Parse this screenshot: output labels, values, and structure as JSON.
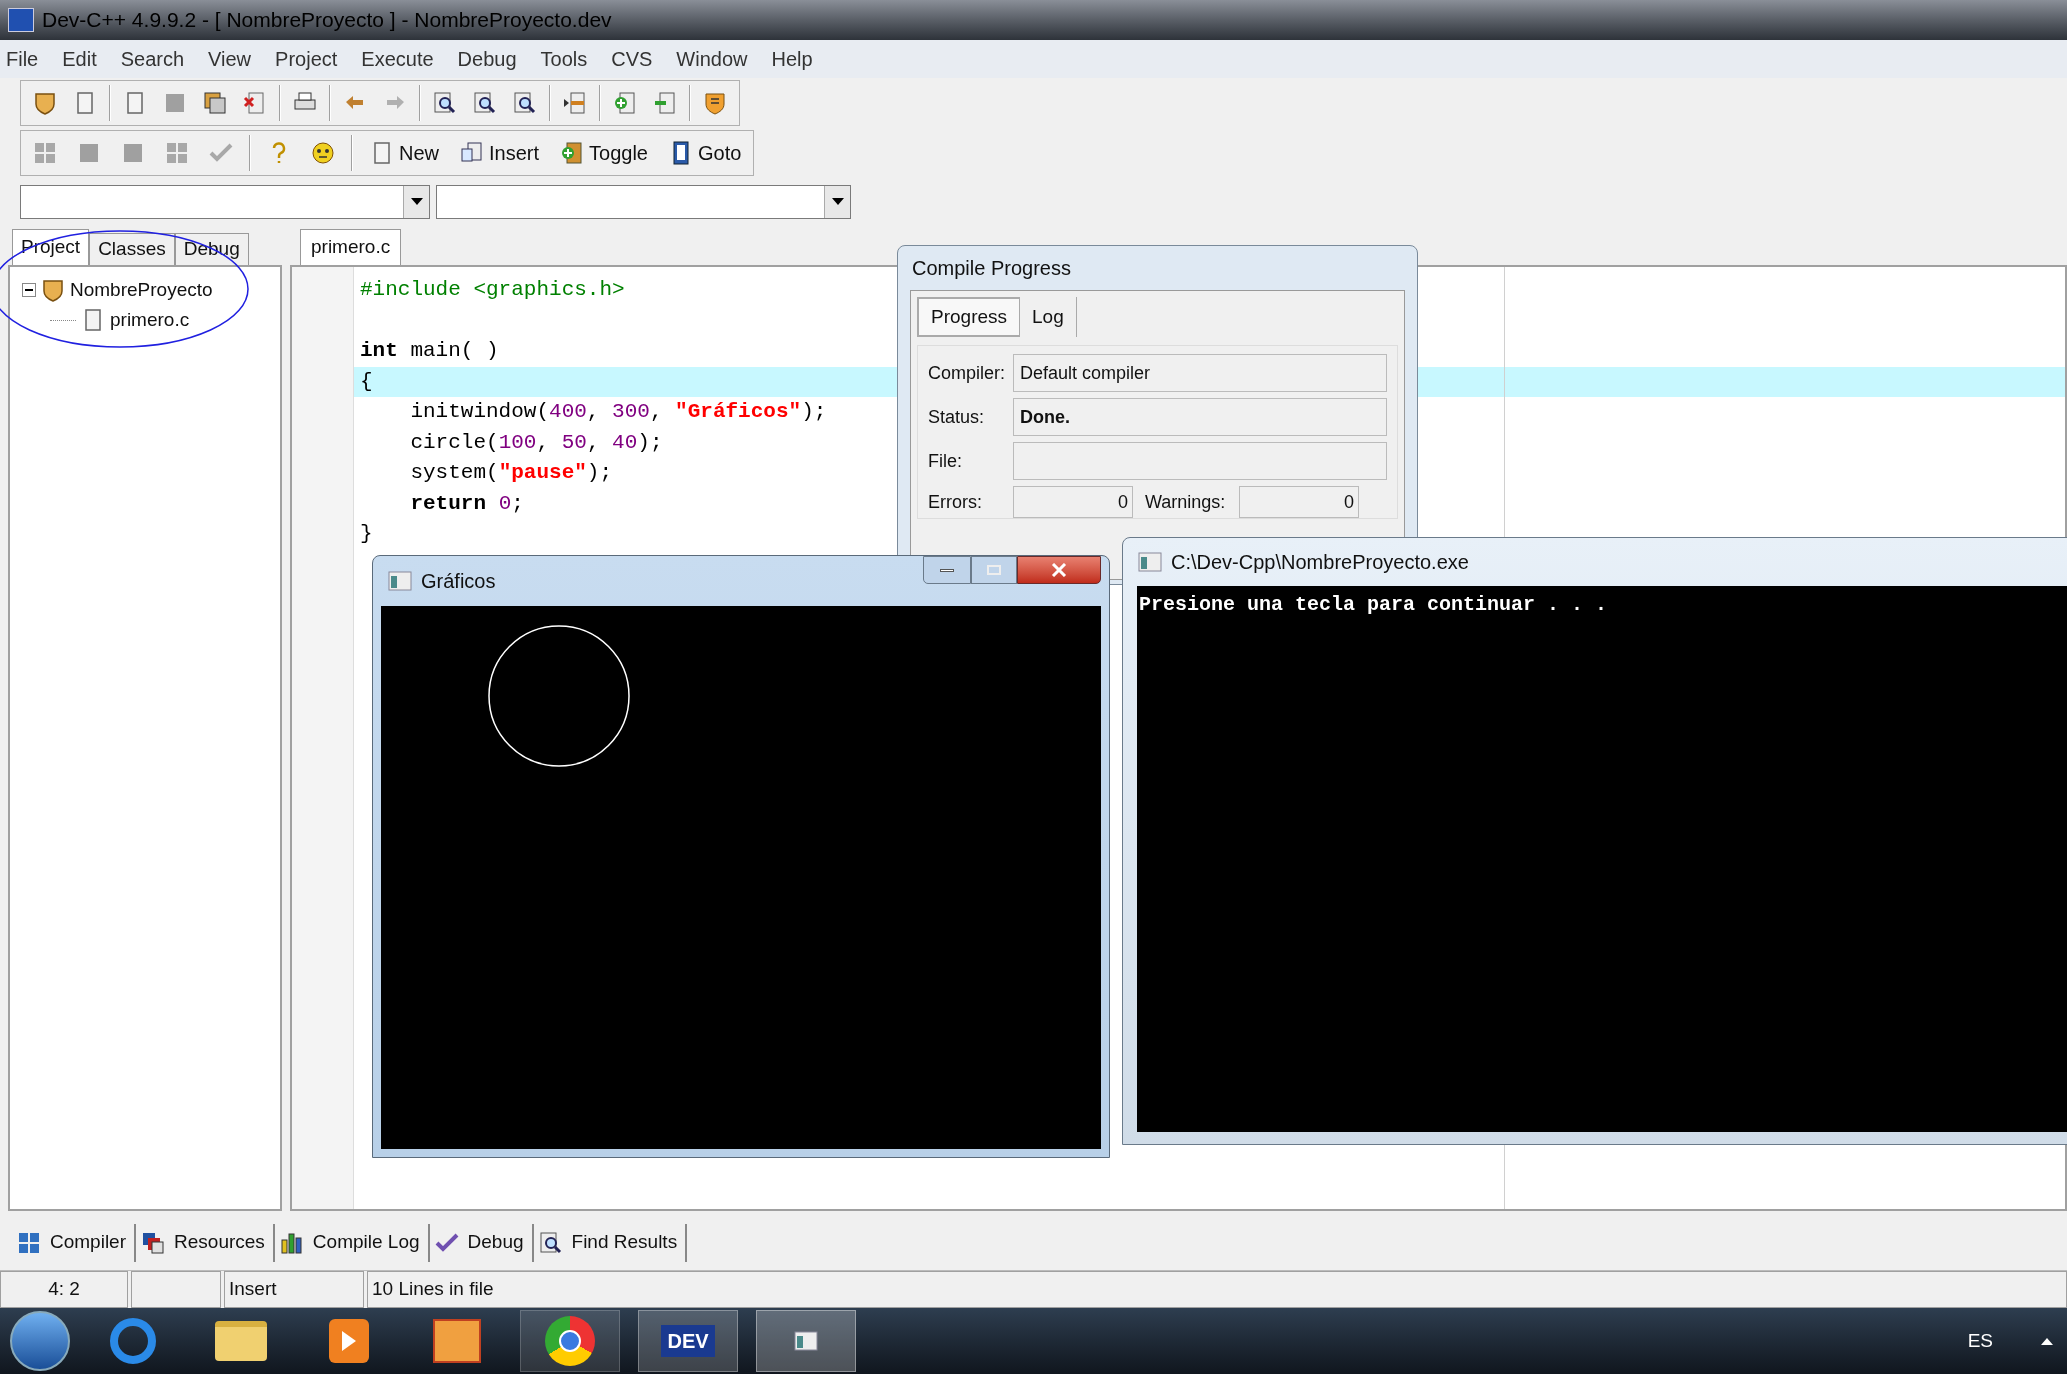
{
  "window": {
    "title": "Dev-C++ 4.9.9.2  - [ NombreProyecto ] - NombreProyecto.dev"
  },
  "menu": [
    "File",
    "Edit",
    "Search",
    "View",
    "Project",
    "Execute",
    "Debug",
    "Tools",
    "CVS",
    "Window",
    "Help"
  ],
  "toolbar_buttons": [
    {
      "label": "New",
      "kind": "page"
    },
    {
      "label": "Insert",
      "kind": "insert"
    },
    {
      "label": "Toggle",
      "kind": "toggle"
    },
    {
      "label": "Goto",
      "kind": "goto"
    }
  ],
  "left_tabs": [
    {
      "label": "Project",
      "selected": true
    },
    {
      "label": "Classes",
      "selected": false
    },
    {
      "label": "Debug",
      "selected": false
    }
  ],
  "project_tree": [
    {
      "label": "NombreProyecto",
      "expanded": true,
      "children": [
        {
          "label": "primero.c"
        }
      ]
    }
  ],
  "editor_tabs": [
    {
      "label": "primero.c",
      "selected": true
    }
  ],
  "code_lines": [
    {
      "highlighted": false,
      "tokens": [
        {
          "text": "#include <graphics.h>",
          "kind": "preproc"
        }
      ]
    },
    {
      "highlighted": false
    },
    {
      "highlighted": false,
      "tokens": [
        {
          "text": "int",
          "kind": "keyword"
        },
        {
          "text": " main( )",
          "kind": "plain"
        }
      ]
    },
    {
      "highlighted": true,
      "tokens": [
        {
          "text": "{",
          "kind": "plain"
        }
      ]
    },
    {
      "highlighted": false,
      "tokens": [
        {
          "text": "    initwindow(",
          "kind": "plain"
        },
        {
          "text": "400",
          "kind": "number"
        },
        {
          "text": ", ",
          "kind": "plain"
        },
        {
          "text": "300",
          "kind": "number"
        },
        {
          "text": ", ",
          "kind": "plain"
        },
        {
          "text": "\"Gráficos\"",
          "kind": "string"
        },
        {
          "text": ");",
          "kind": "plain"
        }
      ]
    },
    {
      "highlighted": false,
      "tokens": [
        {
          "text": "    circle(",
          "kind": "plain"
        },
        {
          "text": "100",
          "kind": "number"
        },
        {
          "text": ", ",
          "kind": "plain"
        },
        {
          "text": "50",
          "kind": "number"
        },
        {
          "text": ", ",
          "kind": "plain"
        },
        {
          "text": "40",
          "kind": "number"
        },
        {
          "text": ");",
          "kind": "plain"
        }
      ]
    },
    {
      "highlighted": false,
      "tokens": [
        {
          "text": "    system(",
          "kind": "plain"
        },
        {
          "text": "\"pause\"",
          "kind": "string"
        },
        {
          "text": ");",
          "kind": "plain"
        }
      ]
    },
    {
      "highlighted": false,
      "tokens": [
        {
          "text": "    return",
          "kind": "keyword"
        },
        {
          "text": " 0",
          "kind": "number"
        },
        {
          "text": ";",
          "kind": "plain"
        }
      ]
    },
    {
      "highlighted": false,
      "tokens": [
        {
          "text": "}",
          "kind": "plain"
        }
      ]
    }
  ],
  "compile_progress": {
    "title": "Compile Progress",
    "tabs": [
      {
        "label": "Progress",
        "selected": true
      },
      {
        "label": "Log",
        "selected": false
      }
    ],
    "compiler_label": "Compiler:",
    "compiler": "Default compiler",
    "status_label": "Status:",
    "status": "Done.",
    "file_label": "File:",
    "errors_label": "Errors:",
    "errors": "0",
    "warnings_label": "Warnings:",
    "warnings": "0"
  },
  "graphics_window": {
    "title": "Gráficos"
  },
  "console_window": {
    "title": "C:\\Dev-Cpp\\NombreProyecto.exe",
    "output": "Presione una tecla para continuar . . ."
  },
  "bottom_tabs": [
    {
      "label": "Compiler",
      "kind": "grid"
    },
    {
      "label": "Resources",
      "kind": "stack"
    },
    {
      "label": "Compile Log",
      "kind": "chart"
    },
    {
      "label": "Debug",
      "kind": "check"
    },
    {
      "label": "Find Results",
      "kind": "find"
    }
  ],
  "status_bar": {
    "position": "4: 2",
    "mode": "Insert",
    "info": "10 Lines in file"
  },
  "taskbar": {
    "dev_label": "DEV",
    "language": "ES"
  }
}
